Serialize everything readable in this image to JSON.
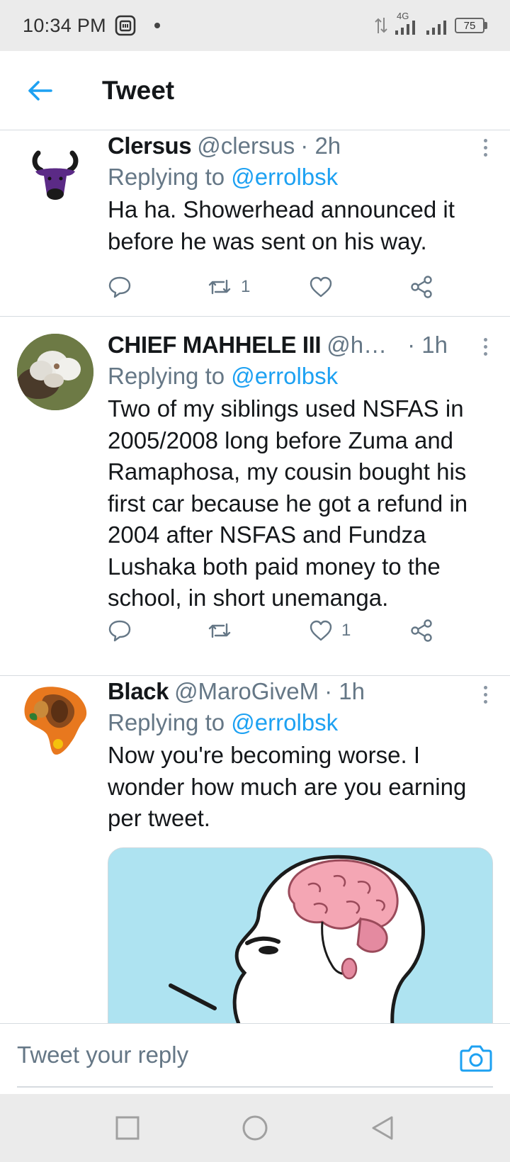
{
  "status_bar": {
    "time": "10:34 PM",
    "network": "4G",
    "battery": "75"
  },
  "header": {
    "title": "Tweet"
  },
  "tweets": [
    {
      "name": "Clersus",
      "handle": "@clersus",
      "time": "· 2h",
      "replying_prefix": "Replying to",
      "replying_to": "@errolbsk",
      "text": "Ha ha. Showerhead announced it before he was sent on his way.",
      "retweets": "1",
      "likes": ""
    },
    {
      "name": "CHIEF MAHHELE III",
      "handle": "@hutt…",
      "time": "· 1h",
      "replying_prefix": "Replying to",
      "replying_to": "@errolbsk",
      "text": "Two of my siblings used NSFAS in 2005/2008 long before Zuma and Ramaphosa, my cousin bought his first car because he got a refund in 2004 after NSFAS and Fundza Lushaka both paid money to the school, in short unemanga.",
      "retweets": "",
      "likes": "1"
    },
    {
      "name": "Black",
      "handle": "@MaroGiveM",
      "time": "· 1h",
      "replying_prefix": "Replying to",
      "replying_to": "@errolbsk",
      "text": "Now you're becoming worse. I wonder how much are you earning per tweet.",
      "retweets": "",
      "likes": ""
    }
  ],
  "reply": {
    "placeholder": "Tweet your reply"
  },
  "colors": {
    "accent": "#1da1f2",
    "secondary_text": "#657786",
    "divider": "#d6dbe0",
    "system_bar": "#ebebeb"
  }
}
